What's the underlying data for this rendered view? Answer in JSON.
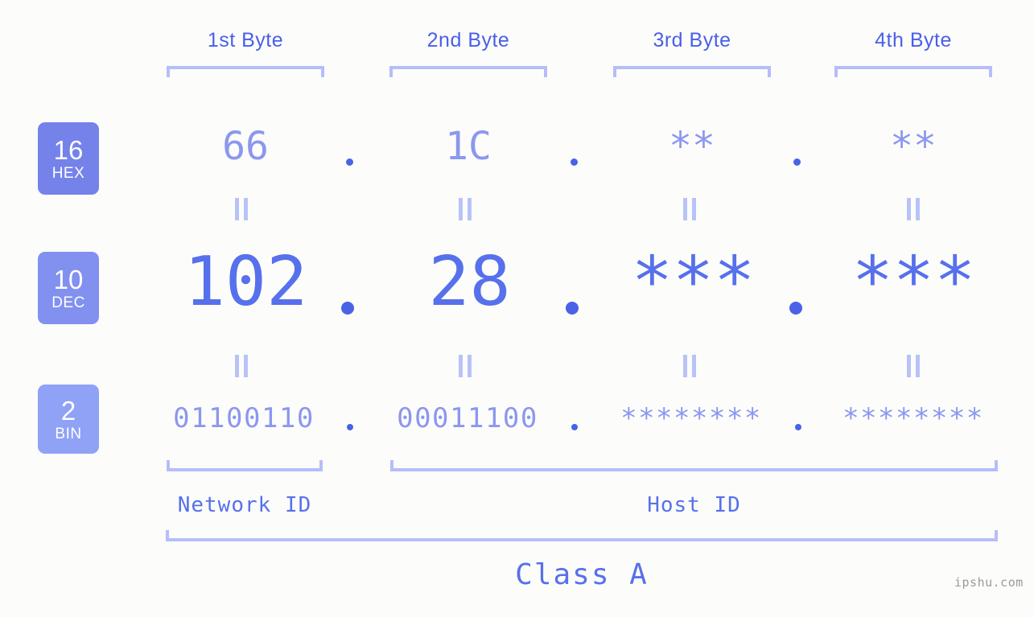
{
  "background_color": "#fcfdfa",
  "accent_color": "#4a5fe8",
  "value_color": "#8c97ef",
  "dec_color": "#5770ec",
  "bracket_color": "#b6bdfb",
  "byte_headers": [
    {
      "label": "1st Byte"
    },
    {
      "label": "2nd Byte"
    },
    {
      "label": "3rd Byte"
    },
    {
      "label": "4th Byte"
    }
  ],
  "rows": [
    {
      "badge_number": "16",
      "badge_name": "HEX",
      "badge_color": "#7482ea",
      "values": [
        "66",
        "1C",
        "**",
        "**"
      ],
      "separator": "."
    },
    {
      "badge_number": "10",
      "badge_name": "DEC",
      "badge_color": "#8290ef",
      "values": [
        "102",
        "28",
        "***",
        "***"
      ],
      "separator": "."
    },
    {
      "badge_number": "2",
      "badge_name": "BIN",
      "badge_color": "#8fa2f6",
      "values": [
        "01100110",
        "00011100",
        "********",
        "********"
      ],
      "separator": "."
    }
  ],
  "equality_symbol": "||",
  "id_sections": [
    {
      "label": "Network ID"
    },
    {
      "label": "Host ID"
    }
  ],
  "class_label": "Class A",
  "watermark": "ipshu.com"
}
